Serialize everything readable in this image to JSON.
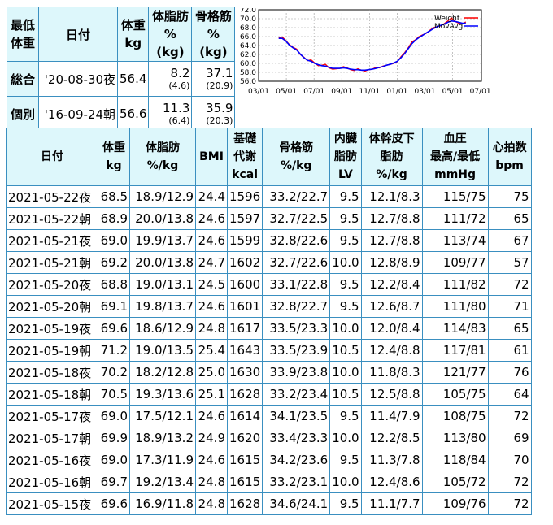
{
  "summary": {
    "headers": {
      "corner": "最低\n体重",
      "date": "日付",
      "weight": "体重\nkg",
      "fat": "体脂肪\n%(kg)",
      "muscle": "骨格筋\n%(kg)"
    },
    "rows": [
      {
        "label": "総合",
        "date": "'20-08-30夜",
        "weight": "56.4",
        "fat": "8.2",
        "fat_kg": "(4.6)",
        "muscle": "37.1",
        "muscle_kg": "(20.9)"
      },
      {
        "label": "個別",
        "date": "'16-09-24朝",
        "weight": "56.6",
        "fat": "11.3",
        "fat_kg": "(6.4)",
        "muscle": "35.9",
        "muscle_kg": "(20.3)"
      }
    ]
  },
  "chart_data": {
    "type": "line",
    "ylim": [
      56.0,
      72.0
    ],
    "yticks": [
      "72.0",
      "70.0",
      "68.0",
      "66.0",
      "64.0",
      "62.0",
      "60.0",
      "58.0",
      "56.0"
    ],
    "xticks": [
      "03/01",
      "05/01",
      "07/01",
      "09/01",
      "11/01",
      "01/01",
      "03/01",
      "05/01",
      "07/01"
    ],
    "grid": true,
    "legend_position": "top-right",
    "series": [
      {
        "name": "Weight",
        "color": "#ff0000",
        "values": [
          65.7,
          65.9,
          65.1,
          64.2,
          63.6,
          63.2,
          62.0,
          61.4,
          60.6,
          60.8,
          60.1,
          59.5,
          59.6,
          59.8,
          59.0,
          58.7,
          58.8,
          58.9,
          59.3,
          59.0,
          58.6,
          58.4,
          58.8,
          58.5,
          58.3,
          58.6,
          58.7,
          59.1,
          59.0,
          59.4,
          59.6,
          59.8,
          60.0,
          60.4,
          61.5,
          62.4,
          63.5,
          64.8,
          65.3,
          66.0,
          66.4,
          66.7,
          67.4,
          68.0,
          68.2,
          68.4,
          68.9,
          69.5,
          70.2,
          69.4,
          69.0,
          68.8,
          69.3
        ]
      },
      {
        "name": "MovAvg",
        "color": "#0000ff",
        "values": [
          65.6,
          65.6,
          65.0,
          64.1,
          63.5,
          63.0,
          62.1,
          61.3,
          60.7,
          60.5,
          60.0,
          59.7,
          59.5,
          59.4,
          59.1,
          58.9,
          58.9,
          58.9,
          59.0,
          58.9,
          58.7,
          58.6,
          58.6,
          58.5,
          58.5,
          58.6,
          58.7,
          58.9,
          59.1,
          59.3,
          59.6,
          59.8,
          60.1,
          60.5,
          61.3,
          62.2,
          63.3,
          64.4,
          65.2,
          65.8,
          66.3,
          66.8,
          67.3,
          67.8,
          68.2,
          68.5,
          68.8,
          69.2,
          69.5,
          69.4,
          69.2,
          69.0,
          69.0
        ]
      }
    ]
  },
  "table": {
    "headers": [
      {
        "l1": "日付",
        "l2": ""
      },
      {
        "l1": "体重",
        "l2": "kg"
      },
      {
        "l1": "体脂肪",
        "l2": "%/kg"
      },
      {
        "l1": "BMI",
        "l2": ""
      },
      {
        "l1": "基礎\n代謝",
        "l2": "kcal"
      },
      {
        "l1": "骨格筋",
        "l2": "%/kg"
      },
      {
        "l1": "内臓\n脂肪",
        "l2": "LV"
      },
      {
        "l1": "体幹皮下\n脂肪",
        "l2": "%/kg"
      },
      {
        "l1": "血圧\n最高/最低",
        "l2": "mmHg"
      },
      {
        "l1": "心拍数",
        "l2": "bpm"
      }
    ],
    "rows": [
      [
        "2021-05-22夜",
        "68.5",
        "18.9/12.9",
        "24.4",
        "1596",
        "33.2/22.7",
        "9.5",
        "12.1/8.3",
        "115/75",
        "75"
      ],
      [
        "2021-05-22朝",
        "68.9",
        "20.0/13.8",
        "24.6",
        "1597",
        "32.7/22.5",
        "9.5",
        "12.7/8.8",
        "111/72",
        "65"
      ],
      [
        "2021-05-21夜",
        "69.0",
        "19.9/13.7",
        "24.6",
        "1599",
        "32.8/22.6",
        "9.5",
        "12.7/8.8",
        "113/74",
        "67"
      ],
      [
        "2021-05-21朝",
        "69.2",
        "20.0/13.8",
        "24.7",
        "1602",
        "32.7/22.6",
        "10.0",
        "12.8/8.9",
        "109/77",
        "57"
      ],
      [
        "2021-05-20夜",
        "68.8",
        "19.0/13.1",
        "24.5",
        "1600",
        "33.1/22.8",
        "9.5",
        "12.2/8.4",
        "111/82",
        "72"
      ],
      [
        "2021-05-20朝",
        "69.1",
        "19.8/13.7",
        "24.6",
        "1601",
        "32.8/22.7",
        "9.5",
        "12.6/8.7",
        "111/80",
        "71"
      ],
      [
        "2021-05-19夜",
        "69.6",
        "18.6/12.9",
        "24.8",
        "1617",
        "33.5/23.3",
        "10.0",
        "12.0/8.4",
        "114/83",
        "65"
      ],
      [
        "2021-05-19朝",
        "71.2",
        "19.0/13.5",
        "25.4",
        "1643",
        "33.5/23.9",
        "10.5",
        "12.4/8.8",
        "117/81",
        "61"
      ],
      [
        "2021-05-18夜",
        "70.2",
        "18.2/12.8",
        "25.0",
        "1630",
        "33.9/23.8",
        "10.0",
        "11.8/8.3",
        "121/77",
        "76"
      ],
      [
        "2021-05-18朝",
        "70.5",
        "19.3/13.6",
        "25.1",
        "1628",
        "33.2/23.4",
        "10.5",
        "12.5/8.8",
        "105/75",
        "64"
      ],
      [
        "2021-05-17夜",
        "69.0",
        "17.5/12.1",
        "24.6",
        "1614",
        "34.1/23.5",
        "9.5",
        "11.4/7.9",
        "108/75",
        "72"
      ],
      [
        "2021-05-17朝",
        "69.9",
        "18.9/13.2",
        "24.9",
        "1620",
        "33.4/23.3",
        "10.0",
        "12.2/8.5",
        "113/80",
        "69"
      ],
      [
        "2021-05-16夜",
        "69.0",
        "17.3/11.9",
        "24.6",
        "1615",
        "34.2/23.6",
        "9.5",
        "11.3/7.8",
        "118/84",
        "70"
      ],
      [
        "2021-05-16朝",
        "69.7",
        "19.2/13.4",
        "24.8",
        "1615",
        "33.2/23.1",
        "10.0",
        "12.4/8.6",
        "105/72",
        "72"
      ],
      [
        "2021-05-15夜",
        "69.6",
        "16.9/11.8",
        "24.8",
        "1628",
        "34.6/24.1",
        "9.5",
        "11.1/7.7",
        "109/76",
        "72"
      ]
    ]
  }
}
